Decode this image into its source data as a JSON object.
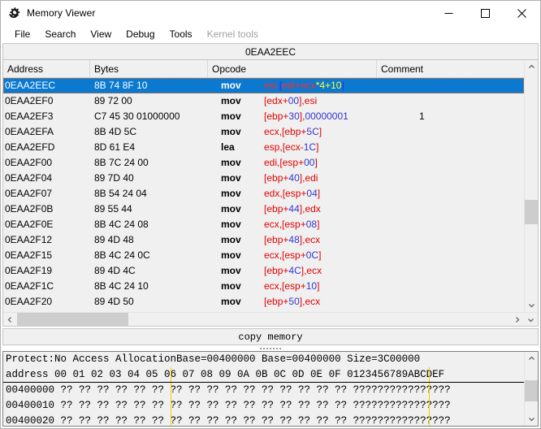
{
  "window": {
    "title": "Memory Viewer",
    "icon": "cheat-engine-gear-icon",
    "minimize": "—",
    "maximize": "□",
    "close": "✕"
  },
  "menu": {
    "items": [
      {
        "label": "File",
        "disabled": false
      },
      {
        "label": "Search",
        "disabled": false
      },
      {
        "label": "View",
        "disabled": false
      },
      {
        "label": "Debug",
        "disabled": false
      },
      {
        "label": "Tools",
        "disabled": false
      },
      {
        "label": "Kernel tools",
        "disabled": true
      }
    ]
  },
  "address_bar": {
    "value": "0EAA2EEC"
  },
  "disassembler": {
    "columns": [
      "Address",
      "Bytes",
      "Opcode",
      "Comment"
    ],
    "rows": [
      {
        "address": "0EAA2EEC",
        "bytes": "8B 74 8F 10",
        "mnemonic": "mov",
        "operands": "esi,[edi+ecx*4+10]",
        "comment": "",
        "selected": true,
        "tokens": [
          {
            "t": "esi",
            "c": "reg"
          },
          {
            "t": ",",
            "c": "pun"
          },
          {
            "t": "[",
            "c": "brk"
          },
          {
            "t": "edi",
            "c": "reg"
          },
          {
            "t": "+",
            "c": "pun"
          },
          {
            "t": "ecx",
            "c": "reg"
          },
          {
            "t": "*",
            "c": "mul"
          },
          {
            "t": "4",
            "c": "mul"
          },
          {
            "t": "+",
            "c": "mul"
          },
          {
            "t": "10",
            "c": "mul"
          },
          {
            "t": "]",
            "c": "brk"
          }
        ]
      },
      {
        "address": "0EAA2EF0",
        "bytes": "89 72 00",
        "mnemonic": "mov",
        "operands": "[edx+00],esi",
        "comment": "",
        "selected": false,
        "tokens": [
          {
            "t": "[",
            "c": "brk"
          },
          {
            "t": "edx",
            "c": "reg"
          },
          {
            "t": "+",
            "c": "pun"
          },
          {
            "t": "00",
            "c": "num"
          },
          {
            "t": "]",
            "c": "brk"
          },
          {
            "t": ",",
            "c": "pun"
          },
          {
            "t": "esi",
            "c": "reg"
          }
        ]
      },
      {
        "address": "0EAA2EF3",
        "bytes": "C7 45 30 01000000",
        "mnemonic": "mov",
        "operands": "[ebp+30],00000001",
        "comment": "1",
        "selected": false,
        "tokens": [
          {
            "t": "[",
            "c": "brk"
          },
          {
            "t": "ebp",
            "c": "reg"
          },
          {
            "t": "+",
            "c": "pun"
          },
          {
            "t": "30",
            "c": "num"
          },
          {
            "t": "]",
            "c": "brk"
          },
          {
            "t": ",",
            "c": "pun"
          },
          {
            "t": "00000001",
            "c": "num"
          }
        ]
      },
      {
        "address": "0EAA2EFA",
        "bytes": "8B 4D 5C",
        "mnemonic": "mov",
        "operands": "ecx,[ebp+5C]",
        "comment": "",
        "selected": false,
        "tokens": [
          {
            "t": "ecx",
            "c": "reg"
          },
          {
            "t": ",",
            "c": "pun"
          },
          {
            "t": "[",
            "c": "brk"
          },
          {
            "t": "ebp",
            "c": "reg"
          },
          {
            "t": "+",
            "c": "pun"
          },
          {
            "t": "5C",
            "c": "num"
          },
          {
            "t": "]",
            "c": "brk"
          }
        ]
      },
      {
        "address": "0EAA2EFD",
        "bytes": "8D 61 E4",
        "mnemonic": "lea",
        "operands": "esp,[ecx-1C]",
        "comment": "",
        "selected": false,
        "tokens": [
          {
            "t": "esp",
            "c": "reg"
          },
          {
            "t": ",",
            "c": "pun"
          },
          {
            "t": "[",
            "c": "brk"
          },
          {
            "t": "ecx",
            "c": "reg"
          },
          {
            "t": "-",
            "c": "pun"
          },
          {
            "t": "1C",
            "c": "num"
          },
          {
            "t": "]",
            "c": "brk"
          }
        ]
      },
      {
        "address": "0EAA2F00",
        "bytes": "8B 7C 24 00",
        "mnemonic": "mov",
        "operands": "edi,[esp+00]",
        "comment": "",
        "selected": false,
        "tokens": [
          {
            "t": "edi",
            "c": "reg"
          },
          {
            "t": ",",
            "c": "pun"
          },
          {
            "t": "[",
            "c": "brk"
          },
          {
            "t": "esp",
            "c": "reg"
          },
          {
            "t": "+",
            "c": "pun"
          },
          {
            "t": "00",
            "c": "num"
          },
          {
            "t": "]",
            "c": "brk"
          }
        ]
      },
      {
        "address": "0EAA2F04",
        "bytes": "89 7D 40",
        "mnemonic": "mov",
        "operands": "[ebp+40],edi",
        "comment": "",
        "selected": false,
        "tokens": [
          {
            "t": "[",
            "c": "brk"
          },
          {
            "t": "ebp",
            "c": "reg"
          },
          {
            "t": "+",
            "c": "pun"
          },
          {
            "t": "40",
            "c": "num"
          },
          {
            "t": "]",
            "c": "brk"
          },
          {
            "t": ",",
            "c": "pun"
          },
          {
            "t": "edi",
            "c": "reg"
          }
        ]
      },
      {
        "address": "0EAA2F07",
        "bytes": "8B 54 24 04",
        "mnemonic": "mov",
        "operands": "edx,[esp+04]",
        "comment": "",
        "selected": false,
        "tokens": [
          {
            "t": "edx",
            "c": "reg"
          },
          {
            "t": ",",
            "c": "pun"
          },
          {
            "t": "[",
            "c": "brk"
          },
          {
            "t": "esp",
            "c": "reg"
          },
          {
            "t": "+",
            "c": "pun"
          },
          {
            "t": "04",
            "c": "num"
          },
          {
            "t": "]",
            "c": "brk"
          }
        ]
      },
      {
        "address": "0EAA2F0B",
        "bytes": "89 55 44",
        "mnemonic": "mov",
        "operands": "[ebp+44],edx",
        "comment": "",
        "selected": false,
        "tokens": [
          {
            "t": "[",
            "c": "brk"
          },
          {
            "t": "ebp",
            "c": "reg"
          },
          {
            "t": "+",
            "c": "pun"
          },
          {
            "t": "44",
            "c": "num"
          },
          {
            "t": "]",
            "c": "brk"
          },
          {
            "t": ",",
            "c": "pun"
          },
          {
            "t": "edx",
            "c": "reg"
          }
        ]
      },
      {
        "address": "0EAA2F0E",
        "bytes": "8B 4C 24 08",
        "mnemonic": "mov",
        "operands": "ecx,[esp+08]",
        "comment": "",
        "selected": false,
        "tokens": [
          {
            "t": "ecx",
            "c": "reg"
          },
          {
            "t": ",",
            "c": "pun"
          },
          {
            "t": "[",
            "c": "brk"
          },
          {
            "t": "esp",
            "c": "reg"
          },
          {
            "t": "+",
            "c": "pun"
          },
          {
            "t": "08",
            "c": "num"
          },
          {
            "t": "]",
            "c": "brk"
          }
        ]
      },
      {
        "address": "0EAA2F12",
        "bytes": "89 4D 48",
        "mnemonic": "mov",
        "operands": "[ebp+48],ecx",
        "comment": "",
        "selected": false,
        "tokens": [
          {
            "t": "[",
            "c": "brk"
          },
          {
            "t": "ebp",
            "c": "reg"
          },
          {
            "t": "+",
            "c": "pun"
          },
          {
            "t": "48",
            "c": "num"
          },
          {
            "t": "]",
            "c": "brk"
          },
          {
            "t": ",",
            "c": "pun"
          },
          {
            "t": "ecx",
            "c": "reg"
          }
        ]
      },
      {
        "address": "0EAA2F15",
        "bytes": "8B 4C 24 0C",
        "mnemonic": "mov",
        "operands": "ecx,[esp+0C]",
        "comment": "",
        "selected": false,
        "tokens": [
          {
            "t": "ecx",
            "c": "reg"
          },
          {
            "t": ",",
            "c": "pun"
          },
          {
            "t": "[",
            "c": "brk"
          },
          {
            "t": "esp",
            "c": "reg"
          },
          {
            "t": "+",
            "c": "pun"
          },
          {
            "t": "0C",
            "c": "num"
          },
          {
            "t": "]",
            "c": "brk"
          }
        ]
      },
      {
        "address": "0EAA2F19",
        "bytes": "89 4D 4C",
        "mnemonic": "mov",
        "operands": "[ebp+4C],ecx",
        "comment": "",
        "selected": false,
        "tokens": [
          {
            "t": "[",
            "c": "brk"
          },
          {
            "t": "ebp",
            "c": "reg"
          },
          {
            "t": "+",
            "c": "pun"
          },
          {
            "t": "4C",
            "c": "num"
          },
          {
            "t": "]",
            "c": "brk"
          },
          {
            "t": ",",
            "c": "pun"
          },
          {
            "t": "ecx",
            "c": "reg"
          }
        ]
      },
      {
        "address": "0EAA2F1C",
        "bytes": "8B 4C 24 10",
        "mnemonic": "mov",
        "operands": "ecx,[esp+10]",
        "comment": "",
        "selected": false,
        "tokens": [
          {
            "t": "ecx",
            "c": "reg"
          },
          {
            "t": ",",
            "c": "pun"
          },
          {
            "t": "[",
            "c": "brk"
          },
          {
            "t": "esp",
            "c": "reg"
          },
          {
            "t": "+",
            "c": "pun"
          },
          {
            "t": "10",
            "c": "num"
          },
          {
            "t": "]",
            "c": "brk"
          }
        ]
      },
      {
        "address": "0EAA2F20",
        "bytes": "89 4D 50",
        "mnemonic": "mov",
        "operands": "[ebp+50],ecx",
        "comment": "",
        "selected": false,
        "tokens": [
          {
            "t": "[",
            "c": "brk"
          },
          {
            "t": "ebp",
            "c": "reg"
          },
          {
            "t": "+",
            "c": "pun"
          },
          {
            "t": "50",
            "c": "num"
          },
          {
            "t": "]",
            "c": "brk"
          },
          {
            "t": ",",
            "c": "pun"
          },
          {
            "t": "ecx",
            "c": "reg"
          }
        ]
      }
    ]
  },
  "copy_bar": {
    "label": "copy memory"
  },
  "hexview": {
    "info": "Protect:No Access  AllocationBase=00400000 Base=00400000 Size=3C00000",
    "column_header": "address  00 01 02 03 04 05 06 07 08 09 0A 0B 0C 0D 0E 0F 0123456789ABCDEF",
    "rows": [
      {
        "address": "00400000",
        "hex": "?? ?? ?? ?? ?? ?? ?? ?? ?? ?? ?? ?? ?? ?? ?? ??",
        "ascii": "????????????????"
      },
      {
        "address": "00400010",
        "hex": "?? ?? ?? ?? ?? ?? ?? ?? ?? ?? ?? ?? ?? ?? ?? ??",
        "ascii": "????????????????"
      },
      {
        "address": "00400020",
        "hex": "?? ?? ?? ?? ?? ?? ?? ?? ?? ?? ?? ?? ?? ?? ?? ??",
        "ascii": "????????????????"
      }
    ]
  },
  "colors": {
    "selection": "#0b79d0",
    "register": "#e00000",
    "number": "#3434d0",
    "scale": "#8a8a00",
    "separator": "#e8d500"
  }
}
